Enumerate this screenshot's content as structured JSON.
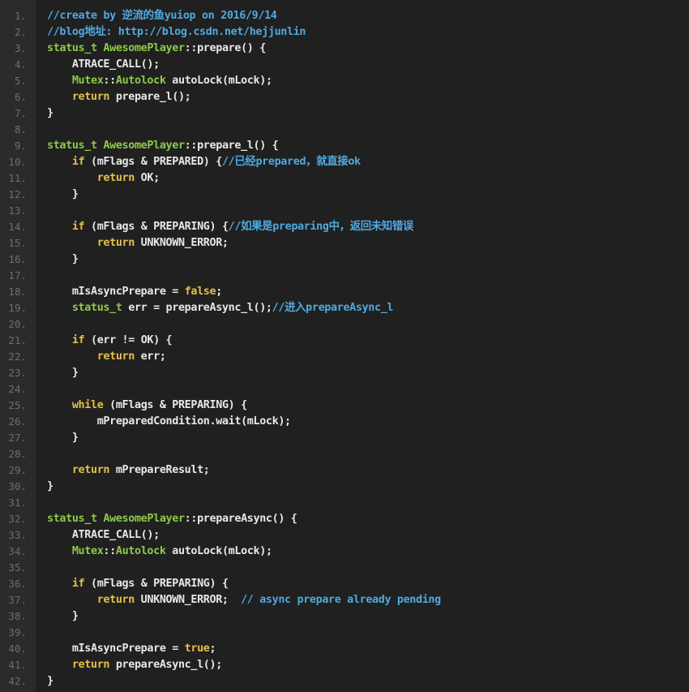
{
  "colors": {
    "background": "#202020",
    "gutter": "#2b2b2b",
    "line_number": "#6e6e6e",
    "plain": "#e8e8e8",
    "keyword": "#e3c04a",
    "type": "#8ec94b",
    "comment": "#4fa9df"
  },
  "lines": [
    {
      "n": "1.",
      "tokens": [
        {
          "t": "comment",
          "v": "//create by 逆流的鱼yuiop on 2016/9/14"
        }
      ]
    },
    {
      "n": "2.",
      "tokens": [
        {
          "t": "comment",
          "v": "//blog地址: http://blog.csdn.net/hejjunlin"
        }
      ]
    },
    {
      "n": "3.",
      "tokens": [
        {
          "t": "type",
          "v": "status_t AwesomePlayer"
        },
        {
          "t": "plain",
          "v": "::prepare() {"
        }
      ]
    },
    {
      "n": "4.",
      "tokens": [
        {
          "t": "plain",
          "v": "    ATRACE_CALL();"
        }
      ]
    },
    {
      "n": "5.",
      "tokens": [
        {
          "t": "type",
          "v": "    Mutex"
        },
        {
          "t": "plain",
          "v": "::"
        },
        {
          "t": "type",
          "v": "Autolock"
        },
        {
          "t": "plain",
          "v": " autoLock(mLock);"
        }
      ]
    },
    {
      "n": "6.",
      "tokens": [
        {
          "t": "kw",
          "v": "    return"
        },
        {
          "t": "plain",
          "v": " prepare_l();"
        }
      ]
    },
    {
      "n": "7.",
      "tokens": [
        {
          "t": "plain",
          "v": "}"
        }
      ]
    },
    {
      "n": "8.",
      "tokens": []
    },
    {
      "n": "9.",
      "tokens": [
        {
          "t": "type",
          "v": "status_t AwesomePlayer"
        },
        {
          "t": "plain",
          "v": "::prepare_l() {"
        }
      ]
    },
    {
      "n": "10.",
      "tokens": [
        {
          "t": "kw",
          "v": "    if"
        },
        {
          "t": "plain",
          "v": " (mFlags & PREPARED) {"
        },
        {
          "t": "comment",
          "v": "//已经prepared，就直接ok"
        }
      ]
    },
    {
      "n": "11.",
      "tokens": [
        {
          "t": "kw",
          "v": "        return"
        },
        {
          "t": "plain",
          "v": " OK;"
        }
      ]
    },
    {
      "n": "12.",
      "tokens": [
        {
          "t": "plain",
          "v": "    }"
        }
      ]
    },
    {
      "n": "13.",
      "tokens": []
    },
    {
      "n": "14.",
      "tokens": [
        {
          "t": "kw",
          "v": "    if"
        },
        {
          "t": "plain",
          "v": " (mFlags & PREPARING) {"
        },
        {
          "t": "comment",
          "v": "//如果是preparing中，返回未知错误"
        }
      ]
    },
    {
      "n": "15.",
      "tokens": [
        {
          "t": "kw",
          "v": "        return"
        },
        {
          "t": "plain",
          "v": " UNKNOWN_ERROR;"
        }
      ]
    },
    {
      "n": "16.",
      "tokens": [
        {
          "t": "plain",
          "v": "    }"
        }
      ]
    },
    {
      "n": "17.",
      "tokens": []
    },
    {
      "n": "18.",
      "tokens": [
        {
          "t": "plain",
          "v": "    mIsAsyncPrepare = "
        },
        {
          "t": "kw",
          "v": "false"
        },
        {
          "t": "plain",
          "v": ";"
        }
      ]
    },
    {
      "n": "19.",
      "tokens": [
        {
          "t": "type",
          "v": "    status_t"
        },
        {
          "t": "plain",
          "v": " err = prepareAsync_l();"
        },
        {
          "t": "comment",
          "v": "//进入prepareAsync_l"
        }
      ]
    },
    {
      "n": "20.",
      "tokens": []
    },
    {
      "n": "21.",
      "tokens": [
        {
          "t": "kw",
          "v": "    if"
        },
        {
          "t": "plain",
          "v": " (err != OK) {"
        }
      ]
    },
    {
      "n": "22.",
      "tokens": [
        {
          "t": "kw",
          "v": "        return"
        },
        {
          "t": "plain",
          "v": " err;"
        }
      ]
    },
    {
      "n": "23.",
      "tokens": [
        {
          "t": "plain",
          "v": "    }"
        }
      ]
    },
    {
      "n": "24.",
      "tokens": []
    },
    {
      "n": "25.",
      "tokens": [
        {
          "t": "kw",
          "v": "    while"
        },
        {
          "t": "plain",
          "v": " (mFlags & PREPARING) {"
        }
      ]
    },
    {
      "n": "26.",
      "tokens": [
        {
          "t": "plain",
          "v": "        mPreparedCondition.wait(mLock);"
        }
      ]
    },
    {
      "n": "27.",
      "tokens": [
        {
          "t": "plain",
          "v": "    }"
        }
      ]
    },
    {
      "n": "28.",
      "tokens": []
    },
    {
      "n": "29.",
      "tokens": [
        {
          "t": "kw",
          "v": "    return"
        },
        {
          "t": "plain",
          "v": " mPrepareResult;"
        }
      ]
    },
    {
      "n": "30.",
      "tokens": [
        {
          "t": "plain",
          "v": "}"
        }
      ]
    },
    {
      "n": "31.",
      "tokens": []
    },
    {
      "n": "32.",
      "tokens": [
        {
          "t": "type",
          "v": "status_t AwesomePlayer"
        },
        {
          "t": "plain",
          "v": "::prepareAsync() {"
        }
      ]
    },
    {
      "n": "33.",
      "tokens": [
        {
          "t": "plain",
          "v": "    ATRACE_CALL();"
        }
      ]
    },
    {
      "n": "34.",
      "tokens": [
        {
          "t": "type",
          "v": "    Mutex"
        },
        {
          "t": "plain",
          "v": "::"
        },
        {
          "t": "type",
          "v": "Autolock"
        },
        {
          "t": "plain",
          "v": " autoLock(mLock);"
        }
      ]
    },
    {
      "n": "35.",
      "tokens": []
    },
    {
      "n": "36.",
      "tokens": [
        {
          "t": "kw",
          "v": "    if"
        },
        {
          "t": "plain",
          "v": " (mFlags & PREPARING) {"
        }
      ]
    },
    {
      "n": "37.",
      "tokens": [
        {
          "t": "kw",
          "v": "        return"
        },
        {
          "t": "plain",
          "v": " UNKNOWN_ERROR;  "
        },
        {
          "t": "comment",
          "v": "// async prepare already pending"
        }
      ]
    },
    {
      "n": "38.",
      "tokens": [
        {
          "t": "plain",
          "v": "    }"
        }
      ]
    },
    {
      "n": "39.",
      "tokens": []
    },
    {
      "n": "40.",
      "tokens": [
        {
          "t": "plain",
          "v": "    mIsAsyncPrepare = "
        },
        {
          "t": "kw",
          "v": "true"
        },
        {
          "t": "plain",
          "v": ";"
        }
      ]
    },
    {
      "n": "41.",
      "tokens": [
        {
          "t": "kw",
          "v": "    return"
        },
        {
          "t": "plain",
          "v": " prepareAsync_l();"
        }
      ]
    },
    {
      "n": "42.",
      "tokens": [
        {
          "t": "plain",
          "v": "}"
        }
      ]
    }
  ]
}
